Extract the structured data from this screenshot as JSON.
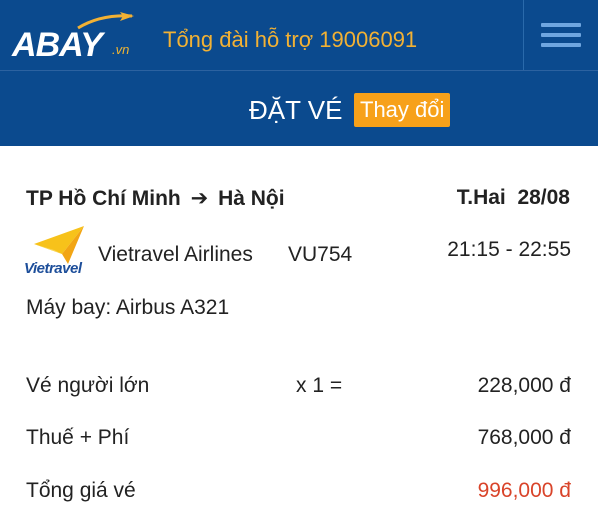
{
  "header": {
    "logo_text": "BAY",
    "logo_prefix": "A",
    "logo_tld": ".vn",
    "hotline": "Tổng đài hỗ trợ 19006091"
  },
  "subheader": {
    "title": "ĐẶT VÉ",
    "change_label": "Thay đổi"
  },
  "flight": {
    "from": "TP Hồ Chí Minh",
    "to": "Hà Nội",
    "arrow": "➔",
    "day": "T.Hai",
    "date": "28/08",
    "airline_logo_text": "Vietravel",
    "airline": "Vietravel Airlines",
    "flight_no": "VU754",
    "time": "21:15 - 22:55",
    "aircraft": "Máy bay: Airbus A321"
  },
  "pricing": {
    "adult_label": "Vé người lớn",
    "adult_qty": "x 1 =",
    "adult_amount": "228,000 đ",
    "tax_label": "Thuế + Phí",
    "tax_amount": "768,000 đ",
    "total_label": "Tổng giá vé",
    "total_amount": "996,000 đ"
  },
  "colors": {
    "header_bg": "#0b4a8e",
    "accent": "#f7a11a",
    "hotline": "#f2b134",
    "total": "#d9442a"
  }
}
